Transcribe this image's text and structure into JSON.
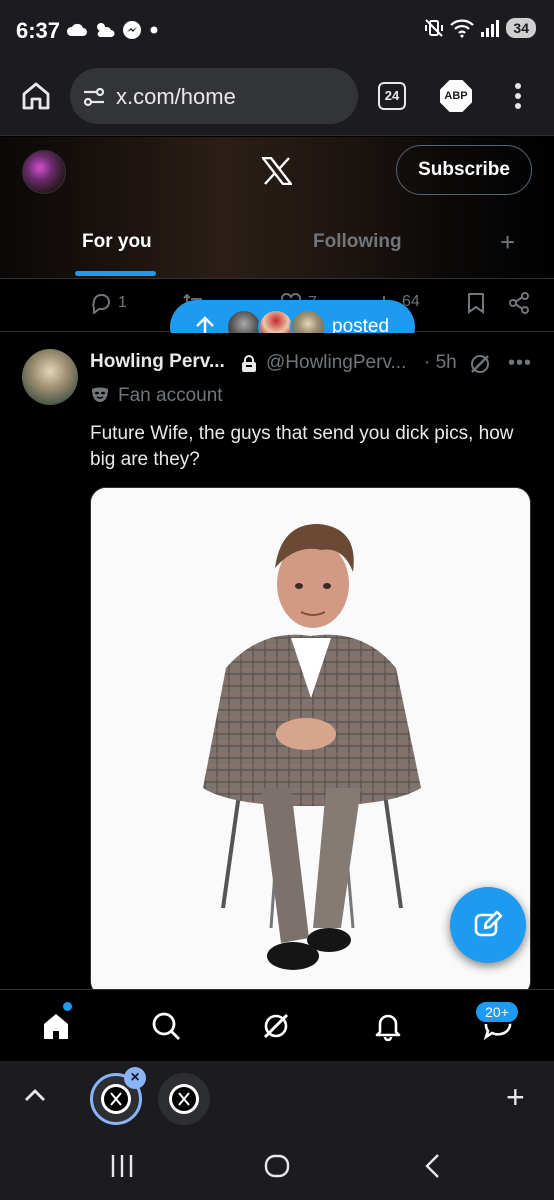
{
  "status_bar": {
    "time": "6:37",
    "battery": "34",
    "signal_label": "5"
  },
  "browser": {
    "url": "x.com/home",
    "tab_count": "24",
    "adblock_label": "ABP"
  },
  "x_header": {
    "subscribe_label": "Subscribe",
    "tabs": [
      {
        "label": "For you",
        "active": true
      },
      {
        "label": "Following",
        "active": false
      }
    ]
  },
  "prev_tweet_actions": {
    "replies": "1",
    "reposts": "",
    "likes": "7",
    "views": "64"
  },
  "new_posts_pill": {
    "label": "posted"
  },
  "tweet": {
    "display_name": "Howling Perv...",
    "handle": "@HowlingPerv...",
    "separator": "·",
    "time": "5h",
    "badge_label": "Fan account",
    "text": "Future Wife, the guys that send you dick pics, how big are they?"
  },
  "bottom_nav": {
    "items": [
      "home-icon",
      "search-icon",
      "grok-icon",
      "notifications-icon",
      "messages-icon"
    ],
    "messages_badge": "20+"
  },
  "colors": {
    "accent": "#1d9bf0",
    "background": "#000000",
    "muted_text": "#71767b",
    "border": "#2f3336"
  }
}
